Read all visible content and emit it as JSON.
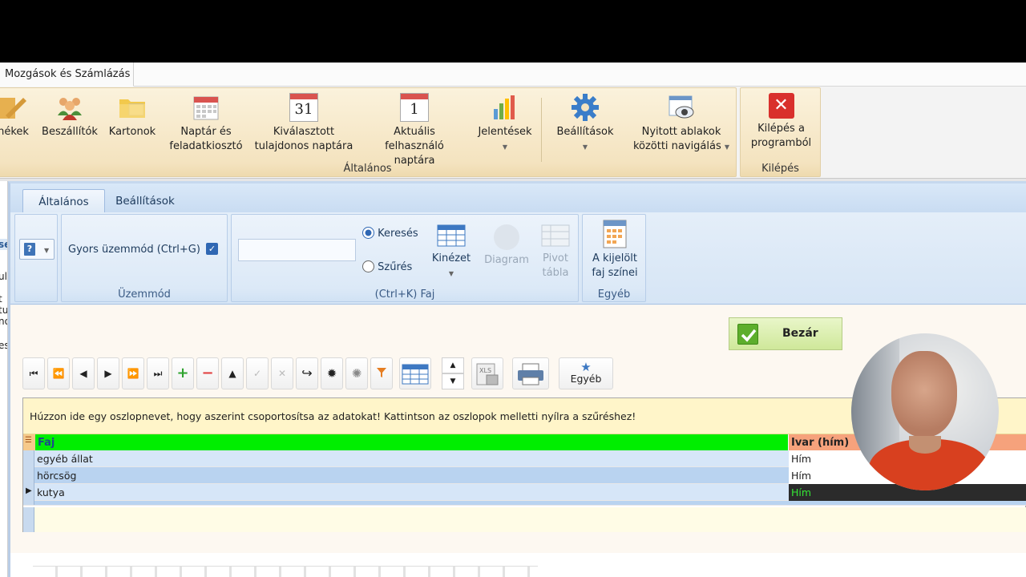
{
  "title_tab": {
    "label": "Mozgások és Számlázás"
  },
  "top_ribbon": {
    "buttons": [
      {
        "label1": "nékek",
        "label2": ""
      },
      {
        "label1": "Beszállítók",
        "label2": ""
      },
      {
        "label1": "Kartonok",
        "label2": ""
      },
      {
        "label1": "Naptár és",
        "label2": "feladatkiosztó"
      },
      {
        "label1": "Kiválasztott",
        "label2": "tulajdonos naptára"
      },
      {
        "label1": "Aktuális",
        "label2": "felhasználó naptára"
      },
      {
        "label1": "Jelentések",
        "label2": ""
      },
      {
        "label1": "Beállítások",
        "label2": ""
      },
      {
        "label1": "Nyitott ablakok",
        "label2": "közötti navigálás"
      },
      {
        "label1": "Kilépés a",
        "label2": "programból"
      }
    ],
    "calendar_day_selected": "31",
    "calendar_day_current": "1",
    "group_general": "Általános",
    "group_exit": "Kilépés"
  },
  "left_strip": {
    "fragments": [
      "se",
      "ula",
      "t tu",
      "no",
      "es"
    ]
  },
  "inner_tabs": {
    "general": "Általános",
    "settings": "Beállítások"
  },
  "inner_ribbon": {
    "fast_mode_label": "Gyors üzemmód (Ctrl+G)",
    "fast_mode_checked": true,
    "group_mode": "Üzemmód",
    "search_value": "",
    "radio_search": "Keresés",
    "radio_filter": "Szűrés",
    "radio_selected": "Keresés",
    "view_label": "Kinézet",
    "diagram_label": "Diagram",
    "pivot_label1": "Pivot",
    "pivot_label2": "tábla",
    "group_search": "(Ctrl+K) Faj",
    "colors_label1": "A kijelölt",
    "colors_label2": "faj színei",
    "group_other": "Egyéb"
  },
  "close_button": {
    "label": "Bezár"
  },
  "toolbar": {
    "other_label": "Egyéb"
  },
  "grid": {
    "group_hint": "Húzzon ide egy oszlopnevet, hogy aszerint csoportosítsa az adatokat! Kattintson az oszlopok melletti nyílra a szűréshez!",
    "columns": [
      "Faj",
      "Ivar (hím)"
    ],
    "rows": [
      {
        "faj": "egyéb állat",
        "ivar": "Hím"
      },
      {
        "faj": "hörcsög",
        "ivar": "Hím"
      },
      {
        "faj": "kutya",
        "ivar": "Hím"
      }
    ],
    "header_color": "#00ee00",
    "ivar_header_color": "#f6a27c"
  }
}
